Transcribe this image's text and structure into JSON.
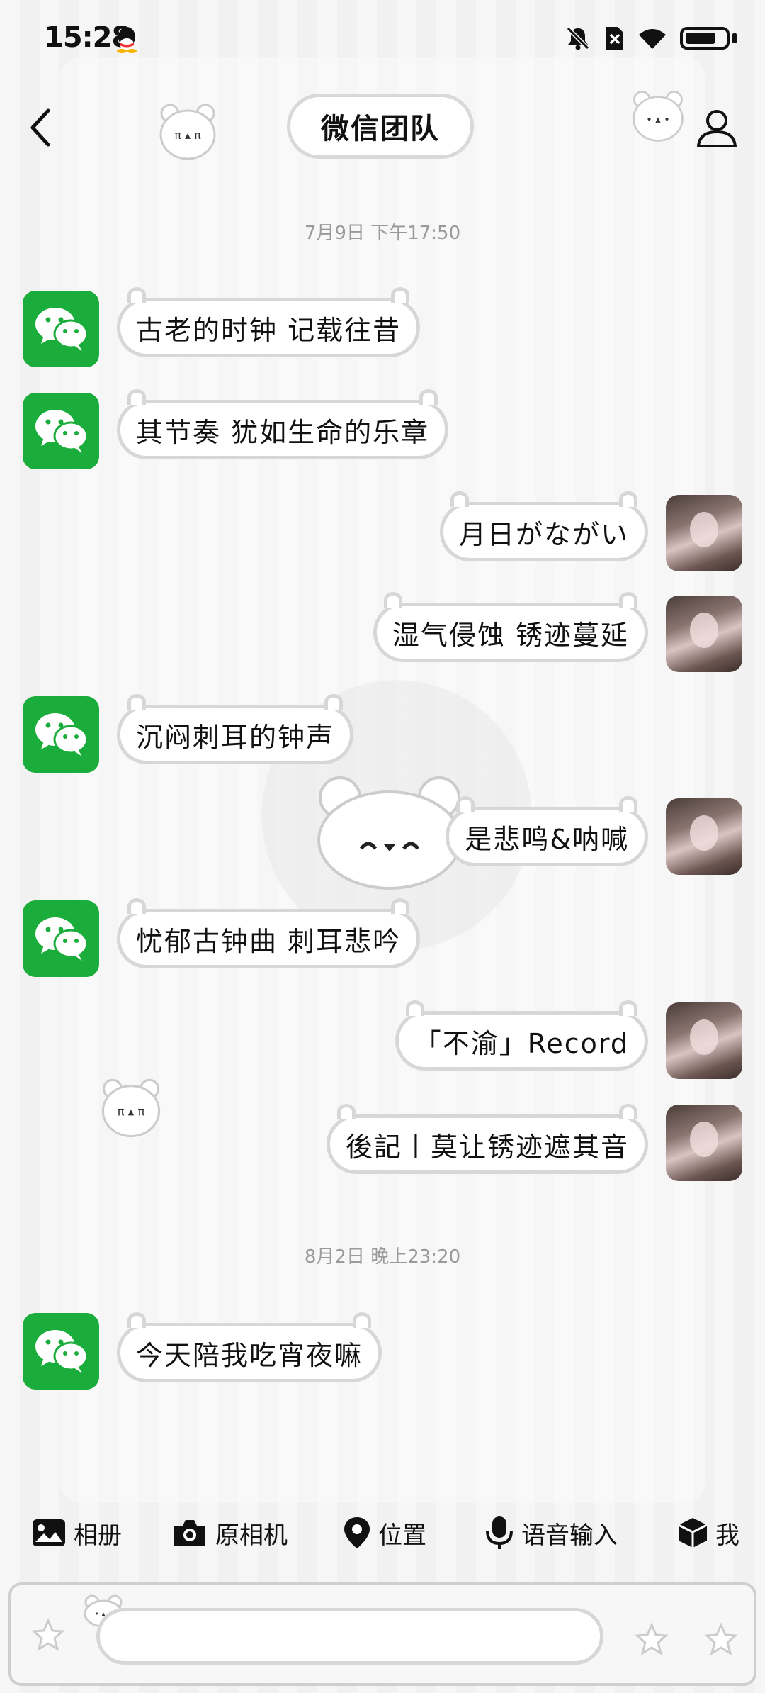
{
  "status_bar": {
    "time": "15:28"
  },
  "header": {
    "title": "微信团队"
  },
  "timestamps": [
    "7月9日 下午17:50",
    "8月2日 晚上23:20"
  ],
  "messages": [
    {
      "side": "left",
      "text": "古老的时钟 记载往昔"
    },
    {
      "side": "left",
      "text": "其节奏 犹如生命的乐章"
    },
    {
      "side": "right",
      "text": "月日がながい"
    },
    {
      "side": "right",
      "text": "湿气侵蚀 锈迹蔓延"
    },
    {
      "side": "left",
      "text": "沉闷刺耳的钟声"
    },
    {
      "side": "right",
      "text": "是悲鸣&呐喊"
    },
    {
      "side": "left",
      "text": "忧郁古钟曲 刺耳悲吟"
    },
    {
      "side": "right",
      "text": "「不渝」Record"
    },
    {
      "side": "right",
      "text": "後記丨莫让锈迹遮其音"
    },
    {
      "side": "left",
      "text": "今天陪我吃宵夜嘛"
    }
  ],
  "toolbar": {
    "album": "相册",
    "camera": "原相机",
    "location": "位置",
    "voice_input": "语音输入",
    "more": "我"
  },
  "input": {
    "placeholder": ""
  },
  "colors": {
    "wechat_green": "#1aad3b",
    "bubble_border": "#d7d7d7",
    "background": "#f3f3f3"
  }
}
